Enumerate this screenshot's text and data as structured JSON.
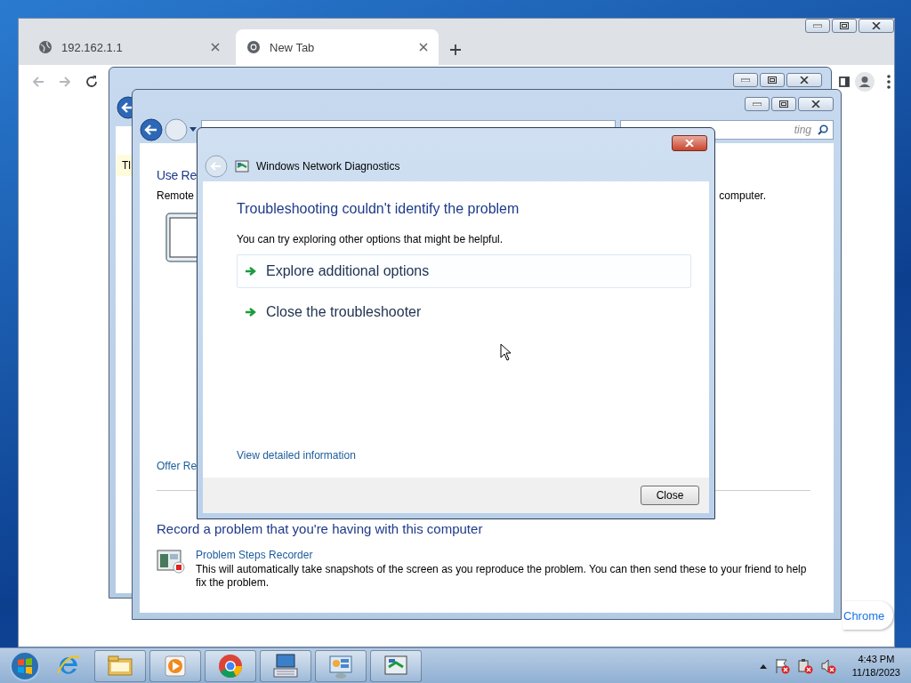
{
  "browser": {
    "tabs": [
      {
        "title": "192.162.1.1",
        "selected": false
      },
      {
        "title": "New Tab",
        "selected": true
      }
    ],
    "bubble": "Chrome"
  },
  "back_window": {
    "notice": "Tl"
  },
  "control_panel": {
    "search": {
      "placeholder": "ting"
    },
    "remote_section": {
      "heading": "Use Re",
      "text": "Remote",
      "text_end": "computer.",
      "link": "Offer Re"
    },
    "record_section": {
      "heading": "Record a problem that you're having with this computer",
      "items": [
        {
          "title": "Problem Steps Recorder",
          "description": "This will automatically take snapshots of the screen as you reproduce the problem. You can then send these to your friend to help fix the problem."
        }
      ]
    }
  },
  "dialog": {
    "title": "Windows Network Diagnostics",
    "heading": "Troubleshooting couldn't identify the problem",
    "intro": "You can try exploring other options that might be helpful.",
    "options": [
      {
        "label": "Explore additional options",
        "hovered": true
      },
      {
        "label": "Close the troubleshooter",
        "hovered": false
      }
    ],
    "details_link": "View detailed information",
    "close_button": "Close"
  },
  "taskbar": {
    "apps": [
      {
        "kind": "ie"
      },
      {
        "kind": "folder"
      },
      {
        "kind": "media"
      },
      {
        "kind": "chrome"
      },
      {
        "kind": "keyboard"
      },
      {
        "kind": "panel"
      },
      {
        "kind": "network"
      }
    ],
    "clock": {
      "time": "4:43 PM",
      "date": "11/18/2023"
    }
  }
}
